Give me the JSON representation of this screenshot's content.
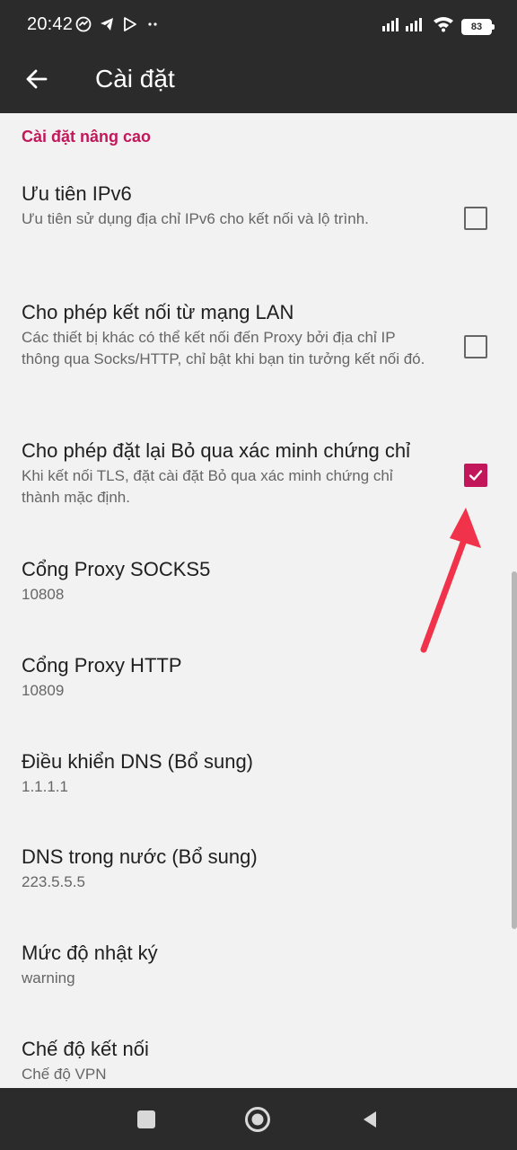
{
  "status": {
    "time": "20:42",
    "battery": "83"
  },
  "header": {
    "title": "Cài đặt"
  },
  "section": {
    "title": "Cài đặt nâng cao"
  },
  "preferences": [
    {
      "title": "Ưu tiên IPv6",
      "summary": "Ưu tiên sử dụng địa chỉ IPv6 cho kết nối và lộ trình.",
      "checked": false
    },
    {
      "title": "Cho phép kết nối từ mạng LAN",
      "summary": "Các thiết bị khác có thể kết nối đến Proxy bởi địa chỉ IP thông qua Socks/HTTP, chỉ bật khi bạn tin tưởng kết nối đó.",
      "checked": false
    },
    {
      "title": "Cho phép đặt lại Bỏ qua xác minh chứng chỉ",
      "summary": "Khi kết nối TLS, đặt cài đặt Bỏ qua xác minh chứng chỉ thành mặc định.",
      "checked": true
    },
    {
      "title": "Cổng Proxy SOCKS5",
      "summary": "10808"
    },
    {
      "title": "Cổng Proxy HTTP",
      "summary": "10809"
    },
    {
      "title": "Điều khiển DNS (Bổ sung)",
      "summary": "1.1.1.1"
    },
    {
      "title": "DNS trong nước (Bổ sung)",
      "summary": "223.5.5.5"
    },
    {
      "title": "Mức độ nhật ký",
      "summary": "warning"
    },
    {
      "title": "Chế độ kết nối",
      "summary": "Chế độ VPN"
    }
  ],
  "colors": {
    "accent": "#c2185b",
    "annotation_arrow": "#f0334a",
    "bar": "#2b2b2b"
  }
}
